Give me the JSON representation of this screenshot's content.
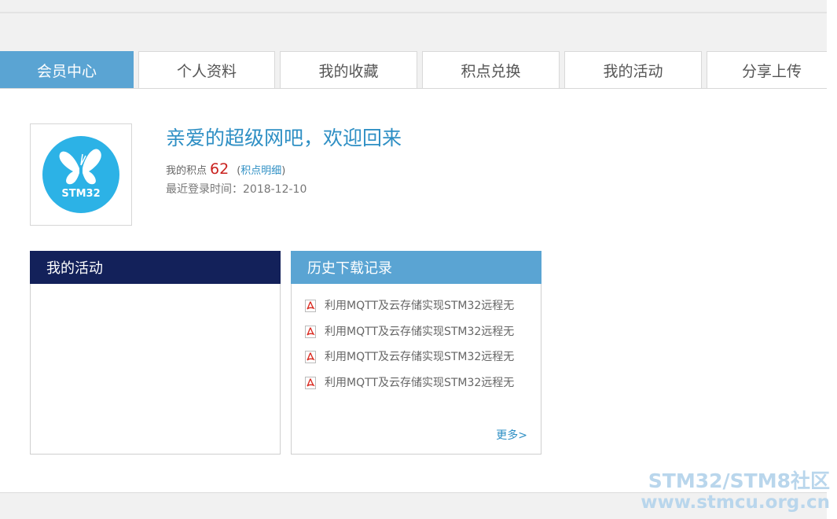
{
  "tabs": [
    {
      "label": "会员中心",
      "active": true
    },
    {
      "label": "个人资料",
      "active": false
    },
    {
      "label": "我的收藏",
      "active": false
    },
    {
      "label": "积点兑换",
      "active": false
    },
    {
      "label": "我的活动",
      "active": false
    },
    {
      "label": "分享上传",
      "active": false
    }
  ],
  "avatar": {
    "logo_text": "STM32",
    "color": "#2cb2e6"
  },
  "welcome": "亲爱的超级网吧，欢迎回来",
  "points": {
    "label": "我的积点",
    "value": "62",
    "link_open": "(",
    "link_label": "积点明细",
    "link_close": ")"
  },
  "last_login": {
    "label": "最近登录时间：",
    "value": "2018-12-10"
  },
  "activity_panel": {
    "title": "我的活动"
  },
  "history_panel": {
    "title": "历史下载记录",
    "items": [
      {
        "icon": "pdf-icon",
        "label": "利用MQTT及云存储实现STM32远程无"
      },
      {
        "icon": "pdf-icon",
        "label": "利用MQTT及云存储实现STM32远程无"
      },
      {
        "icon": "pdf-icon",
        "label": "利用MQTT及云存储实现STM32远程无"
      },
      {
        "icon": "pdf-icon",
        "label": "利用MQTT及云存储实现STM32远程无"
      }
    ],
    "more_label": "更多>"
  },
  "watermark": {
    "line1": "STM32/STM8社区",
    "line2": "www.stmcu.org.cn"
  }
}
